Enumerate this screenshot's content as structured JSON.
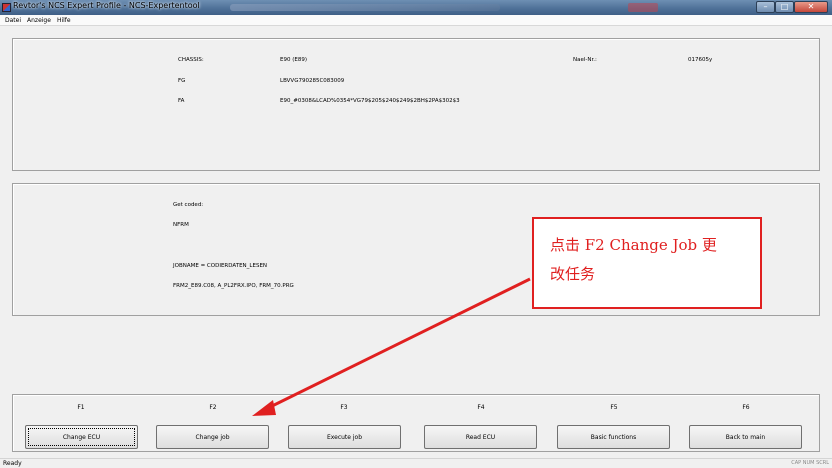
{
  "window": {
    "title": "Revtor's NCS Expert Profile - NCS-Expertentool",
    "buttons": {
      "minimize": "–",
      "maximize": "□",
      "close": "✕"
    }
  },
  "menu": [
    "Datei",
    "Anzeige",
    "Hilfe"
  ],
  "vehicle_info": {
    "chassis_label": "CHASSIS:",
    "chassis_value": "E90 (E89)",
    "fg_label": "FG",
    "fg_value": "LBVVG790285C083009",
    "fa_label": "FA",
    "fa_value": "E90_#0308&LCAD%0354*VG79$205$240$249$2BH$2PA$302$3",
    "nael_label": "Nael-Nr.:",
    "nael_value": "017605y"
  },
  "job_info": {
    "status": "Get coded:",
    "ecu": "NFRM",
    "jobname": "JOBNAME = CODIERDATEN_LESEN",
    "file": "FRM2_E89.C08, A_PL2FRX.IPO, FRM_70.PRG"
  },
  "function_keys": [
    "F1",
    "F2",
    "F3",
    "F4",
    "F5",
    "F6"
  ],
  "buttons": [
    "Change ECU",
    "Change job",
    "Execute job",
    "Read ECU",
    "Basic functions",
    "Back to main"
  ],
  "annotation": {
    "line1": "点击 F2 Change Job 更",
    "line2": "改任务",
    "color": "#e02020"
  },
  "status": {
    "left": "Ready",
    "right": "CAP NUM SCRL"
  }
}
